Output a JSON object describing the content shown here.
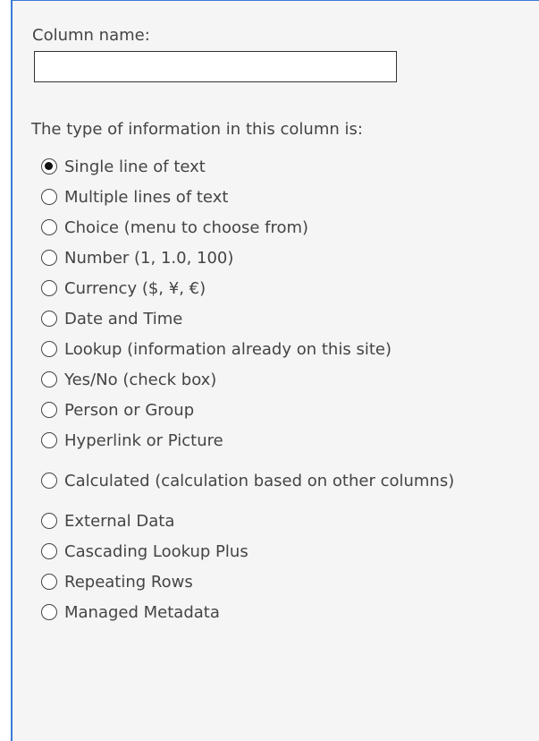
{
  "column_name": {
    "label": "Column name:",
    "value": "",
    "placeholder": ""
  },
  "type_section": {
    "label": "The type of information in this column is:",
    "selected": "Single line of text",
    "options": [
      {
        "label": "Single line of text",
        "checked": true
      },
      {
        "label": "Multiple lines of text",
        "checked": false
      },
      {
        "label": "Choice (menu to choose from)",
        "checked": false
      },
      {
        "label": "Number (1, 1.0, 100)",
        "checked": false
      },
      {
        "label": "Currency ($, ¥, €)",
        "checked": false
      },
      {
        "label": "Date and Time",
        "checked": false
      },
      {
        "label": "Lookup (information already on this site)",
        "checked": false
      },
      {
        "label": "Yes/No (check box)",
        "checked": false
      },
      {
        "label": "Person or Group",
        "checked": false
      },
      {
        "label": "Hyperlink or Picture",
        "checked": false
      },
      {
        "label": "Calculated (calculation based on other columns)",
        "checked": false
      },
      {
        "label": "External Data",
        "checked": false
      },
      {
        "label": "Cascading Lookup Plus",
        "checked": false
      },
      {
        "label": "Repeating Rows",
        "checked": false
      },
      {
        "label": "Managed Metadata",
        "checked": false
      }
    ]
  },
  "colors": {
    "panel_background": "#f5f5f5",
    "panel_border": "#3a7bd5",
    "text": "#444444"
  }
}
